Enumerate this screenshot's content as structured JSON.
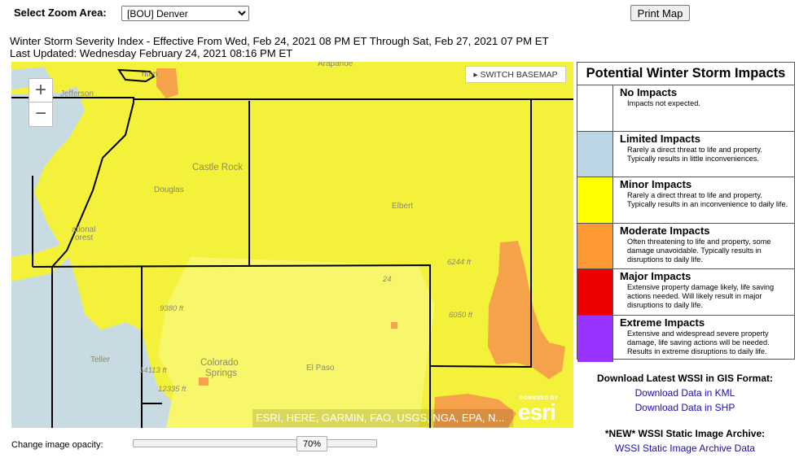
{
  "controls": {
    "zoom_label": "Select Zoom Area:",
    "zoom_selected": "[BOU] Denver",
    "print_label": "Print Map",
    "opacity_label": "Change image opacity:",
    "opacity_value": "70%",
    "opacity_fraction": 0.7
  },
  "header": {
    "line1": "Winter Storm Severity Index - Effective From Wed, Feb 24, 2021 08 PM ET Through Sat, Feb 27, 2021 07 PM ET",
    "line2": "Last Updated: Wednesday February 24, 2021 08:16 PM ET"
  },
  "map": {
    "zoom_in": "+",
    "zoom_out": "−",
    "switch_basemap": "SWITCH BASEMAP",
    "attribution": "ESRI, HERE, GARMIN, FAO, USGS, NGA, EPA, N...",
    "logo_powered": "POWERED BY",
    "logo_word": "esri",
    "places": {
      "arapahoe": "Arapahoe",
      "jefferson": "Jefferson",
      "castle_rock": "Castle Rock",
      "douglas": "Douglas",
      "elbert": "Elbert",
      "national": "ational",
      "forest": "orest",
      "teller": "Teller",
      "colorado": "Colorado",
      "springs": "Springs",
      "el_paso": "El Paso",
      "elev_6244": "6244 ft",
      "elev_6050": "6050 ft",
      "elev_9380": "9380 ft",
      "elev_14113": "14113 ft",
      "elev_12335": "12335 ft",
      "route_24": "24",
      "denver_partial": "nton"
    }
  },
  "legend": {
    "title": "Potential Winter Storm Impacts",
    "items": [
      {
        "name": "No Impacts",
        "desc": "Impacts not expected.",
        "color": "#ffffff"
      },
      {
        "name": "Limited Impacts",
        "desc": "Rarely a direct threat to life and property. Typically results in little inconveniences.",
        "color": "#bcd6e6"
      },
      {
        "name": "Minor Impacts",
        "desc": "Rarely a direct threat to life and property. Typically results in an inconvenience to daily life.",
        "color": "#ffff00"
      },
      {
        "name": "Moderate Impacts",
        "desc": "Often threatening to life and property, some damage unavoidable. Typically results in disruptions to daily life.",
        "color": "#ff9933"
      },
      {
        "name": "Major Impacts",
        "desc": "Extensive property damage likely, life saving actions needed. Will likely result in major disruptions to daily life.",
        "color": "#ee0000"
      },
      {
        "name": "Extreme Impacts",
        "desc": "Extensive and widespread severe property damage, life saving actions will be needed. Results in extreme disruptions to daily life.",
        "color": "#9933ff"
      }
    ]
  },
  "downloads": {
    "gis_title": "Download Latest WSSI in GIS Format:",
    "kml": "Download Data in KML",
    "shp": "Download Data in SHP",
    "archive_title": "*NEW* WSSI Static Image Archive:",
    "archive_link": "WSSI Static Image Archive Data"
  }
}
